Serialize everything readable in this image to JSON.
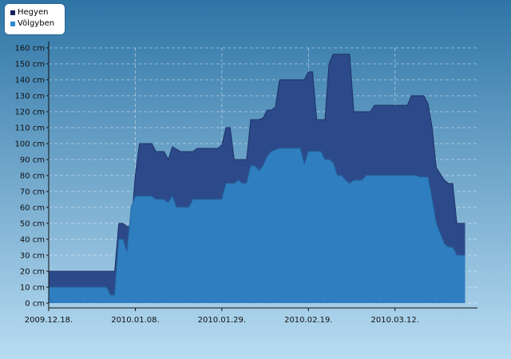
{
  "chart_data": {
    "type": "area",
    "title": "",
    "xlabel": "",
    "ylabel": "",
    "ylim": [
      0,
      160
    ],
    "y_tick_step": 10,
    "y_unit": "cm",
    "grid": true,
    "legend_position": "top-left",
    "x_tick_labels": [
      "2009.12.18.",
      "2010.01.08.",
      "2010.01.29.",
      "2010.02.19.",
      "2010.03.12."
    ],
    "x_tick_dates": [
      "2009-12-18",
      "2010-01-08",
      "2010-01-29",
      "2010-02-19",
      "2010-03-12"
    ],
    "x_range": [
      "2009-12-18",
      "2010-04-01"
    ],
    "colors": {
      "background_top": "#2e75a6",
      "background_bottom": "#b8dcf2",
      "hegyen": "#2c4a8a",
      "volgyben": "#2f7fc0"
    },
    "series": [
      {
        "name": "Hegyen",
        "color": "#2c4a8a",
        "points": [
          [
            "2009-12-18",
            20
          ],
          [
            "2010-01-03",
            20
          ],
          [
            "2010-01-04",
            50
          ],
          [
            "2010-01-05",
            50
          ],
          [
            "2010-01-06",
            48
          ],
          [
            "2010-01-07",
            48
          ],
          [
            "2010-01-08",
            80
          ],
          [
            "2010-01-09",
            100
          ],
          [
            "2010-01-12",
            100
          ],
          [
            "2010-01-13",
            95
          ],
          [
            "2010-01-15",
            95
          ],
          [
            "2010-01-16",
            90
          ],
          [
            "2010-01-17",
            98
          ],
          [
            "2010-01-19",
            95
          ],
          [
            "2010-01-22",
            95
          ],
          [
            "2010-01-23",
            97
          ],
          [
            "2010-01-28",
            97
          ],
          [
            "2010-01-29",
            99
          ],
          [
            "2010-01-30",
            110
          ],
          [
            "2010-01-31",
            110
          ],
          [
            "2010-02-01",
            90
          ],
          [
            "2010-02-04",
            90
          ],
          [
            "2010-02-05",
            115
          ],
          [
            "2010-02-07",
            115
          ],
          [
            "2010-02-08",
            116
          ],
          [
            "2010-02-09",
            121
          ],
          [
            "2010-02-10",
            121
          ],
          [
            "2010-02-11",
            123
          ],
          [
            "2010-02-12",
            140
          ],
          [
            "2010-02-18",
            140
          ],
          [
            "2010-02-19",
            145
          ],
          [
            "2010-02-20",
            145
          ],
          [
            "2010-02-21",
            115
          ],
          [
            "2010-02-23",
            115
          ],
          [
            "2010-02-24",
            150
          ],
          [
            "2010-02-25",
            156
          ],
          [
            "2010-03-01",
            156
          ],
          [
            "2010-03-02",
            120
          ],
          [
            "2010-03-06",
            120
          ],
          [
            "2010-03-07",
            124
          ],
          [
            "2010-03-15",
            124
          ],
          [
            "2010-03-16",
            130
          ],
          [
            "2010-03-19",
            130
          ],
          [
            "2010-03-20",
            125
          ],
          [
            "2010-03-21",
            110
          ],
          [
            "2010-03-22",
            85
          ],
          [
            "2010-03-24",
            77
          ],
          [
            "2010-03-25",
            75
          ],
          [
            "2010-03-26",
            75
          ],
          [
            "2010-03-27",
            50
          ],
          [
            "2010-03-29",
            50
          ]
        ]
      },
      {
        "name": "Völgyben",
        "color": "#2f7fc0",
        "points": [
          [
            "2009-12-18",
            10
          ],
          [
            "2010-01-01",
            10
          ],
          [
            "2010-01-02",
            5
          ],
          [
            "2010-01-03",
            5
          ],
          [
            "2010-01-04",
            40
          ],
          [
            "2010-01-05",
            40
          ],
          [
            "2010-01-06",
            32
          ],
          [
            "2010-01-07",
            60
          ],
          [
            "2010-01-08",
            67
          ],
          [
            "2010-01-12",
            67
          ],
          [
            "2010-01-13",
            65
          ],
          [
            "2010-01-15",
            65
          ],
          [
            "2010-01-16",
            63
          ],
          [
            "2010-01-17",
            67
          ],
          [
            "2010-01-18",
            60
          ],
          [
            "2010-01-21",
            60
          ],
          [
            "2010-01-22",
            65
          ],
          [
            "2010-01-29",
            65
          ],
          [
            "2010-01-30",
            75
          ],
          [
            "2010-02-01",
            75
          ],
          [
            "2010-02-02",
            77
          ],
          [
            "2010-02-03",
            75
          ],
          [
            "2010-02-04",
            75
          ],
          [
            "2010-02-05",
            86
          ],
          [
            "2010-02-06",
            86
          ],
          [
            "2010-02-07",
            83
          ],
          [
            "2010-02-08",
            86
          ],
          [
            "2010-02-09",
            92
          ],
          [
            "2010-02-10",
            95
          ],
          [
            "2010-02-12",
            97
          ],
          [
            "2010-02-17",
            97
          ],
          [
            "2010-02-18",
            87
          ],
          [
            "2010-02-19",
            95
          ],
          [
            "2010-02-22",
            95
          ],
          [
            "2010-02-23",
            90
          ],
          [
            "2010-02-24",
            90
          ],
          [
            "2010-02-25",
            88
          ],
          [
            "2010-02-26",
            80
          ],
          [
            "2010-02-27",
            80
          ],
          [
            "2010-02-28",
            77
          ],
          [
            "2010-03-01",
            75
          ],
          [
            "2010-03-02",
            77
          ],
          [
            "2010-03-04",
            77
          ],
          [
            "2010-03-05",
            80
          ],
          [
            "2010-03-17",
            80
          ],
          [
            "2010-03-18",
            79
          ],
          [
            "2010-03-20",
            79
          ],
          [
            "2010-03-21",
            65
          ],
          [
            "2010-03-22",
            50
          ],
          [
            "2010-03-24",
            37
          ],
          [
            "2010-03-25",
            35
          ],
          [
            "2010-03-26",
            35
          ],
          [
            "2010-03-27",
            30
          ],
          [
            "2010-03-29",
            30
          ]
        ]
      }
    ]
  }
}
